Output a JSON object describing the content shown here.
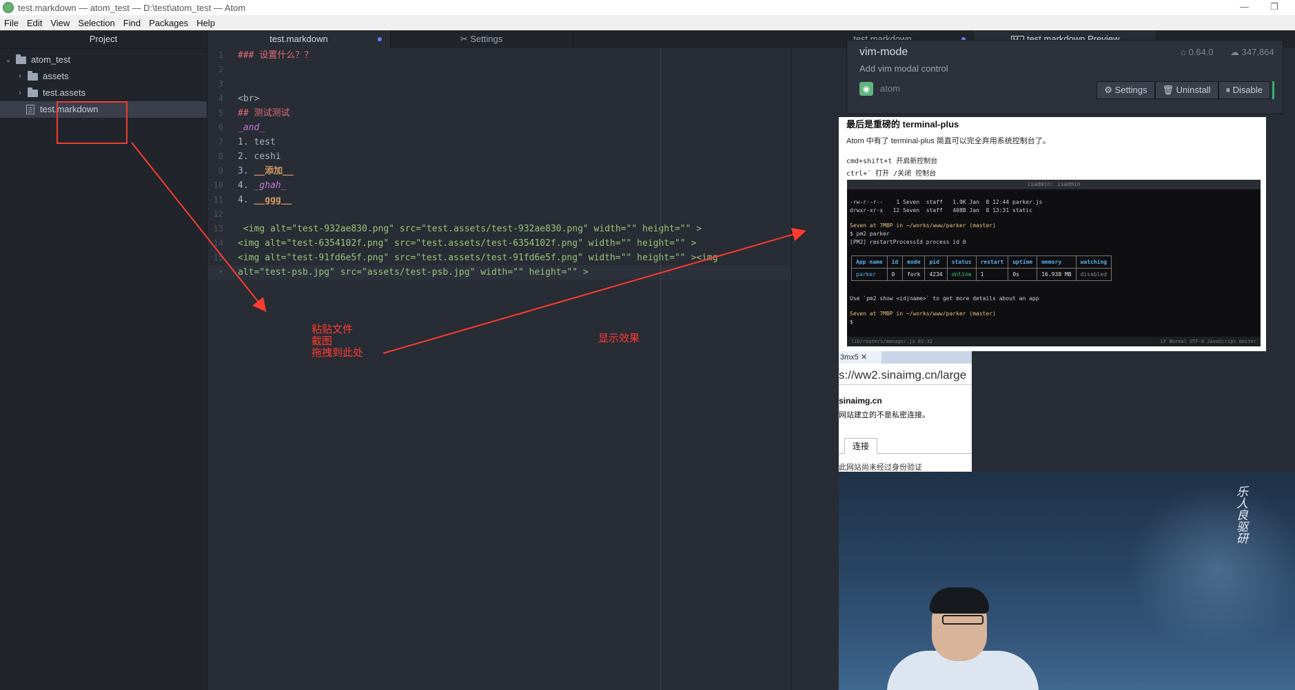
{
  "window": {
    "title": "test.markdown — atom_test — D:\\test\\atom_test — Atom",
    "minimize": "—",
    "restore": "❐"
  },
  "menu": [
    "File",
    "Edit",
    "View",
    "Selection",
    "Find",
    "Packages",
    "Help"
  ],
  "tree": {
    "header": "Project",
    "root": "atom_test",
    "items": [
      {
        "label": "assets",
        "type": "folder"
      },
      {
        "label": "test.assets",
        "type": "folder"
      },
      {
        "label": "test.markdown",
        "type": "file",
        "selected": true
      }
    ]
  },
  "tabs_left": [
    {
      "label": "test.markdown",
      "modified": true,
      "active": true
    },
    {
      "label": "Settings",
      "icon": "settings-icon"
    }
  ],
  "tabs_right": [
    {
      "label": "test.markdown",
      "modified": true
    },
    {
      "label": "test.markdown Preview",
      "icon": "markdown-icon",
      "active": true
    }
  ],
  "editor": {
    "lines": [
      {
        "n": "1",
        "text": "### 设置什么？？",
        "style": "red"
      },
      {
        "n": "2",
        "text": ""
      },
      {
        "n": "3",
        "text": ""
      },
      {
        "n": "4",
        "text": "<br>",
        "style": "tag"
      },
      {
        "n": "5",
        "text": "## 测试测试",
        "style": "red"
      },
      {
        "n": "6",
        "text": "_and_",
        "style": "purple"
      },
      {
        "n": "7",
        "text": "1. test"
      },
      {
        "n": "8",
        "text": "2. ceshi"
      },
      {
        "n": "9",
        "prefix": "3. ",
        "text": "__添加__",
        "style": "orange"
      },
      {
        "n": "10",
        "prefix": "4. ",
        "text": "_ghah_",
        "style": "purple"
      },
      {
        "n": "11",
        "prefix": "4. ",
        "text": "__ggg__",
        "style": "orange"
      },
      {
        "n": "12",
        "text": ""
      },
      {
        "n": "13",
        "text": " <img alt=\"test-932ae830.png\" src=\"test.assets/test-932ae830.png\" width=\"\" height=\"\" >",
        "style": "img"
      },
      {
        "n": "14",
        "text": "<img alt=\"test-6354102f.png\" src=\"test.assets/test-6354102f.png\" width=\"\" height=\"\" >",
        "style": "img"
      },
      {
        "n": "15",
        "text": "<img alt=\"test-91fd6e5f.png\" src=\"test.assets/test-91fd6e5f.png\" width=\"\" height=\"\" ><img",
        "style": "img"
      },
      {
        "n": "•",
        "text": "alt=\"test-psb.jpg\" src=\"assets/test-psb.jpg\" width=\"\" height=\"\" >",
        "style": "img",
        "current": true
      }
    ]
  },
  "package_card": {
    "name": "vim-mode",
    "description": "Add vim modal control",
    "owner": "atom",
    "version": "0.64.0",
    "downloads": "347,864",
    "buttons": {
      "settings": "Settings",
      "uninstall": "Uninstall",
      "disable": "Disable"
    }
  },
  "preview": {
    "heading": "最后是重磅的 terminal-plus",
    "para": "Atom 中有了 terminal-plus 简直可以完全弃用系统控制台了。",
    "kbd1": "cmd+shift+t 开启新控制台",
    "kbd2": "ctrl+` 打开 /关闭 控制台",
    "terminal": {
      "title": "isadmin: isadmin",
      "line1": "-rw-r--r--    1 Seven  staff   1.9K Jan  8 12:44 parker.js",
      "line2": "drwxr-xr-x   12 Seven  staff   408B Jan  8 13:31 static",
      "prompt1": "Seven at 7MBP in ~/works/www/parker (master)",
      "cmd1": "$ pm2 parker",
      "pm2": "[PM2] restartProcessId process id 0",
      "table_headers": [
        "App name",
        "id",
        "mode",
        "pid",
        "status",
        "restart",
        "uptime",
        "memory",
        "watching"
      ],
      "table_row": [
        "parker",
        "0",
        "fork",
        "4234",
        "online",
        "1",
        "0s",
        "16.938 MB",
        "disabled"
      ],
      "hint": "Use `pm2 show <id|name>` to get more details about an app",
      "prompt2": "Seven at 7MBP in ~/works/www/parker (master)",
      "cmd2": "$",
      "status_left": "lib/routers/manager.js   82:32",
      "status_right": "LF   Normal   UTF-8   JavaScript   master"
    }
  },
  "browser_shot": {
    "tab": "3mx5",
    "url": "s://ww2.sinaimg.cn/large",
    "domain": "sinaimg.cn",
    "message": "网站建立的不是私密连接。",
    "conn_tab": "连接",
    "message2": "此网站尚未经过身份验证"
  },
  "photo": {
    "calligraphy": "乐人良驱研"
  },
  "annotations": {
    "paste_line1": "粘贴文件",
    "paste_line2": "截图",
    "paste_line3": "拖拽到此处",
    "display": "显示效果"
  },
  "colors": {
    "editor_bg": "#282c34",
    "panel_bg": "#21252b",
    "annotation_red": "#ff3b30",
    "accent_blue": "#568af2",
    "disable_green": "#2bb673"
  }
}
